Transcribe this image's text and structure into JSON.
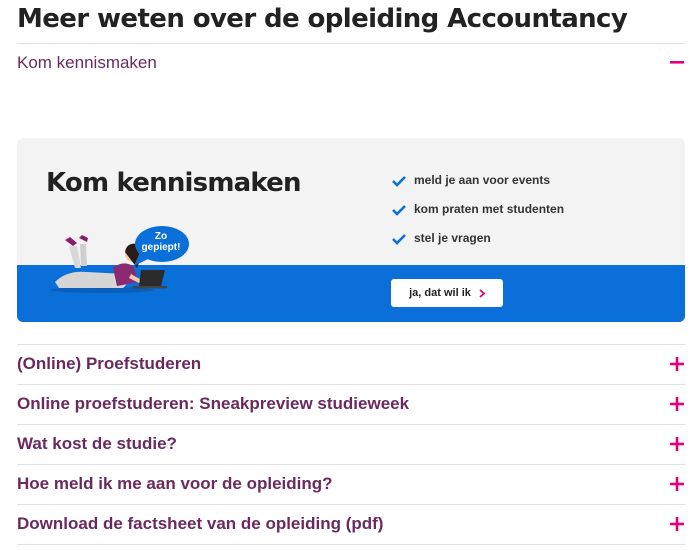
{
  "page": {
    "title": "Meer weten over de opleiding Accountancy"
  },
  "accordion": {
    "open_item": {
      "label": "Kom kennismaken",
      "icon": "minus-icon"
    },
    "items": [
      {
        "label": "(Online) Proefstuderen",
        "icon": "plus-icon"
      },
      {
        "label": "Online proefstuderen: Sneakpreview studieweek",
        "icon": "plus-icon"
      },
      {
        "label": "Wat kost de studie?",
        "icon": "plus-icon"
      },
      {
        "label": "Hoe meld ik me aan voor de opleiding?",
        "icon": "plus-icon"
      },
      {
        "label": "Download de factsheet van de opleiding (pdf)",
        "icon": "plus-icon"
      }
    ]
  },
  "promo": {
    "title": "Kom kennismaken",
    "bubble_line1": "Zo",
    "bubble_line2": "gepiept!",
    "checklist": [
      "meld je aan voor events",
      "kom praten met studenten",
      "stel je vragen"
    ],
    "cta_label": "ja, dat wil ik"
  },
  "colors": {
    "accent_pink": "#e6007e",
    "heading_purple": "#6b2a5e",
    "promo_blue": "#0a6fd8",
    "promo_bg": "#f3f3f3"
  }
}
